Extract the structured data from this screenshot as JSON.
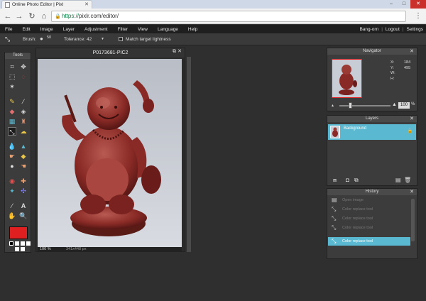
{
  "browser": {
    "tab_title": "Online Photo Editor | Pixl",
    "url_scheme": "https://",
    "url_rest": "pixlr.com/editor/"
  },
  "menu": {
    "items": [
      "File",
      "Edit",
      "Image",
      "Layer",
      "Adjustment",
      "Filter",
      "View",
      "Language",
      "Help"
    ],
    "user": "Bang-orn",
    "logout": "Logout",
    "settings": "Settings"
  },
  "options": {
    "brush_label": "Brush:",
    "brush_size": "50",
    "tolerance_label": "Tolerance:",
    "tolerance_value": "42",
    "match_label": "Match target lightness"
  },
  "tools": {
    "title": "Tools",
    "fg_color": "#e02020"
  },
  "document": {
    "title": "P0173681-PIC2",
    "zoom": "100 %",
    "size": "341x448 px"
  },
  "navigator": {
    "title": "Navigator",
    "x_label": "X:",
    "x_value": "184",
    "y_label": "Y:",
    "y_value": "495",
    "w_label": "W:",
    "h_label": "H:",
    "zoom_value": "100",
    "zoom_unit": "%"
  },
  "layers": {
    "title": "Layers",
    "items": [
      {
        "name": "Background"
      }
    ]
  },
  "history": {
    "title": "History",
    "items": [
      {
        "label": "Open image"
      },
      {
        "label": "Color replace tool"
      },
      {
        "label": "Color replace tool"
      },
      {
        "label": "Color replace tool"
      },
      {
        "label": "Color replace tool"
      }
    ]
  },
  "colors": {
    "accent": "#5ab9d0",
    "menu_bg": "#1f1f1f",
    "panel_bg": "#3c3c3c"
  }
}
